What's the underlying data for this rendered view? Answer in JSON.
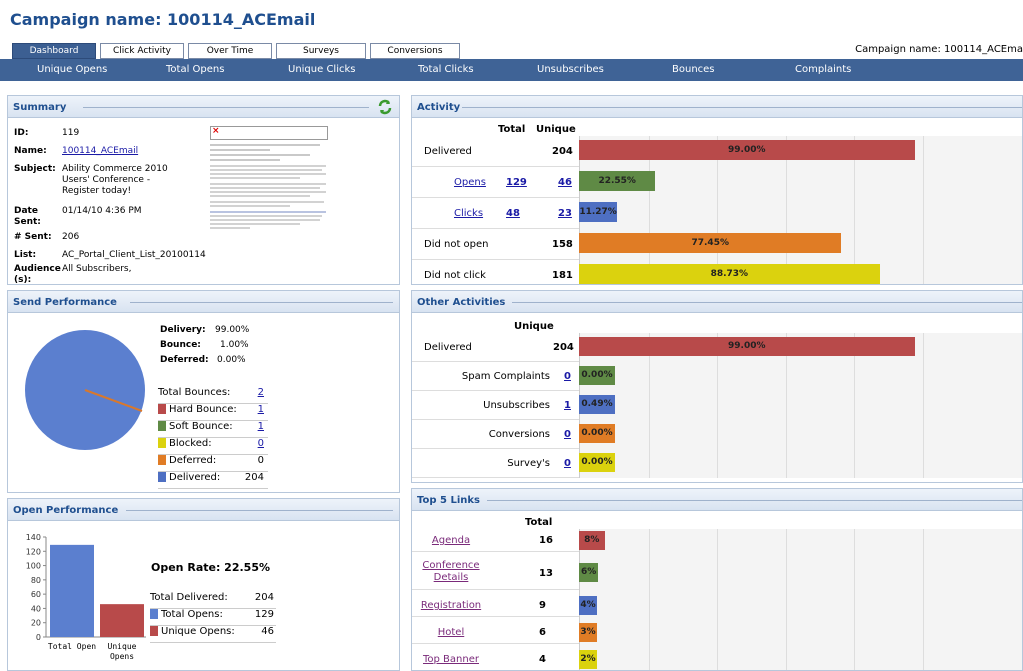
{
  "page": {
    "title": "Campaign name: 100114_ACEmail",
    "campaign_right": "Campaign name: 100114_ACEma"
  },
  "tabs": [
    "Dashboard",
    "Click Activity",
    "Over Time",
    "Surveys",
    "Conversions"
  ],
  "nav": [
    "Unique Opens",
    "Total Opens",
    "Unique Clicks",
    "Total Clicks",
    "Unsubscribes",
    "Bounces",
    "Complaints"
  ],
  "summary": {
    "header": "Summary",
    "id_label": "ID:",
    "id": "119",
    "name_label": "Name:",
    "name": "100114_ACEmail",
    "subject_label": "Subject:",
    "subject_l1": "Ability Commerce 2010",
    "subject_l2": "Users' Conference -",
    "subject_l3": "Register today!",
    "date_label_1": "Date",
    "date_label_2": "Sent:",
    "date": "01/14/10 4:36 PM",
    "sent_label": "# Sent:",
    "sent": "206",
    "list_label": "List:",
    "list": "AC_Portal_Client_List_20100114",
    "audience_label_1": "Audience",
    "audience_label_2": "(s):",
    "audience": "All Subscribers,"
  },
  "send_perf": {
    "header": "Send Performance",
    "delivery_label": "Delivery:",
    "delivery": "99.00%",
    "bounce_label": "Bounce:",
    "bounce": "1.00%",
    "deferred_label": "Deferred:",
    "deferred": "0.00%",
    "total_bounces_label": "Total Bounces:",
    "total_bounces": "2",
    "hard_label": "Hard Bounce:",
    "hard": "1",
    "soft_label": "Soft Bounce:",
    "soft": "1",
    "blocked_label": "Blocked:",
    "blocked": "0",
    "deferred2_label": "Deferred:",
    "deferred2": "0",
    "delivered_label": "Delivered:",
    "delivered": "204"
  },
  "open_perf": {
    "header": "Open Performance",
    "open_rate": "Open Rate: 22.55%",
    "total_delivered_label": "Total Delivered:",
    "total_delivered": "204",
    "total_opens_label": "Total Opens:",
    "total_opens": "129",
    "unique_opens_label": "Unique Opens:",
    "unique_opens": "46",
    "y_ticks": [
      "140",
      "120",
      "100",
      "80",
      "60",
      "40",
      "20",
      "0"
    ],
    "cat1": "Total Open",
    "cat2a": "Unique",
    "cat2b": "Opens"
  },
  "activity": {
    "header": "Activity",
    "col_total": "Total",
    "col_unique": "Unique",
    "rows": [
      {
        "label": "Delivered",
        "total": "",
        "unique": "204",
        "pct": "99.00%"
      },
      {
        "label": "Opens",
        "total": "129",
        "unique": "46",
        "pct": "22.55%"
      },
      {
        "label": "Clicks",
        "total": "48",
        "unique": "23",
        "pct": "11.27%"
      },
      {
        "label": "Did not open",
        "total": "",
        "unique": "158",
        "pct": "77.45%"
      },
      {
        "label": "Did not click",
        "total": "",
        "unique": "181",
        "pct": "88.73%"
      }
    ]
  },
  "other": {
    "header": "Other Activities",
    "col_unique": "Unique",
    "rows": [
      {
        "label": "Delivered",
        "unique": "204",
        "pct": "99.00%"
      },
      {
        "label": "Spam Complaints",
        "unique": "0",
        "pct": "0.00%"
      },
      {
        "label": "Unsubscribes",
        "unique": "1",
        "pct": "0.49%"
      },
      {
        "label": "Conversions",
        "unique": "0",
        "pct": "0.00%"
      },
      {
        "label": "Survey's",
        "unique": "0",
        "pct": "0.00%"
      }
    ]
  },
  "links": {
    "header": "Top 5 Links",
    "col_total": "Total",
    "rows": [
      {
        "label": "Agenda",
        "total": "16",
        "pct": "8%"
      },
      {
        "label": "Conference Details",
        "total": "13",
        "pct": "6%"
      },
      {
        "label": "Registration",
        "total": "9",
        "pct": "4%"
      },
      {
        "label": "Hotel",
        "total": "6",
        "pct": "3%"
      },
      {
        "label": "Top Banner",
        "total": "4",
        "pct": "2%"
      }
    ]
  },
  "chart_data": {
    "type": "bar",
    "categories": [
      "Total Open",
      "Unique Opens"
    ],
    "values": [
      129,
      46
    ],
    "ylim": [
      0,
      140
    ]
  },
  "colors": {
    "red": "#b84a4a",
    "green": "#5f8a45",
    "blue": "#4e6fc2",
    "orange": "#e07c25",
    "yellow": "#dbd20e",
    "header_blue": "#3f6396"
  }
}
